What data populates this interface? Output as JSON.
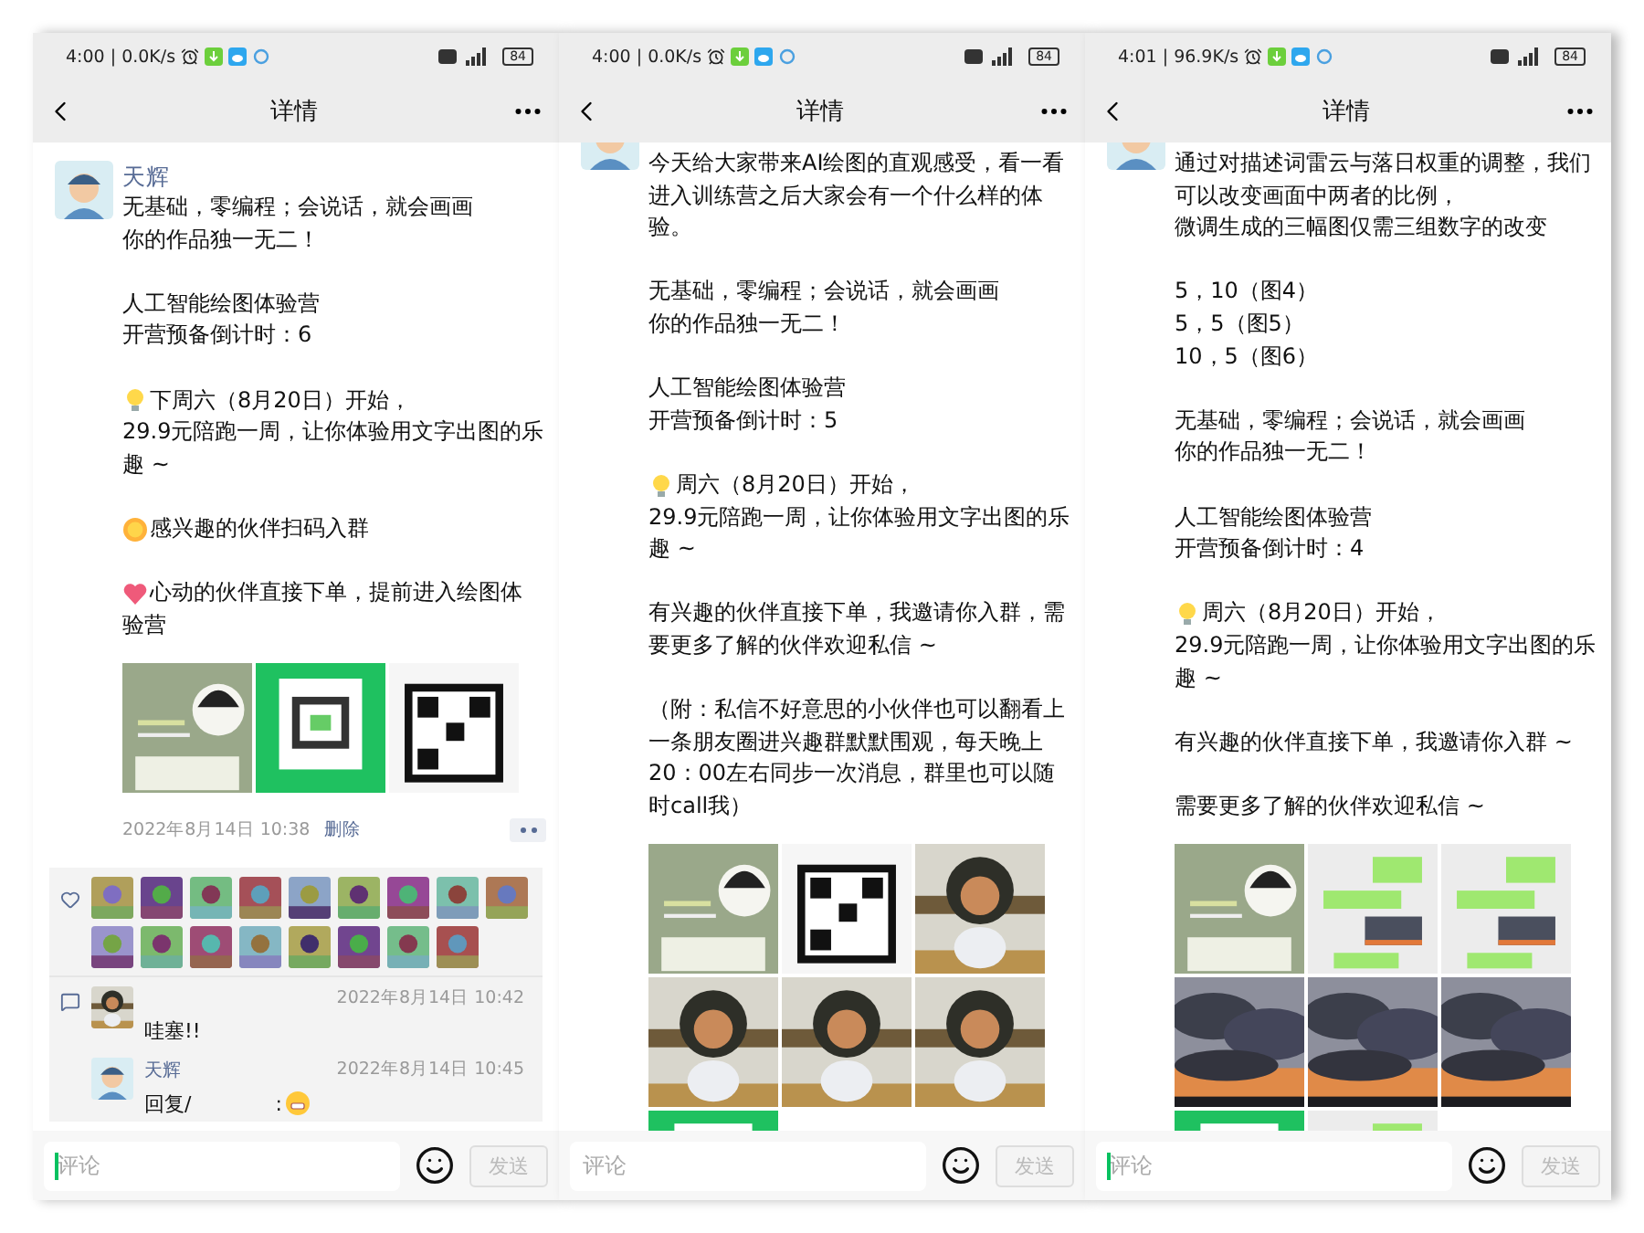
{
  "phones": [
    {
      "status": {
        "time": "4:00 | 0.0K/s",
        "battery": "84"
      },
      "title": "详情",
      "post": {
        "author": "天辉",
        "paragraphs": [
          {
            "lines": [
              "无基础，零编程；会说话，就会画画",
              "你的作品独一无二！"
            ]
          },
          {
            "lines": [
              "人工智能绘图体验营",
              "开营预备倒计时：6"
            ]
          },
          {
            "kind": "bulb",
            "lines": [
              "下周六（8月20日）开始，",
              "29.9元陪跑一周，让你体验用文字出图的乐",
              "趣 ~"
            ]
          },
          {
            "kind": "sun",
            "lines": [
              "感兴趣的伙伴扫码入群"
            ]
          },
          {
            "kind": "heart",
            "lines": [
              "心动的伙伴直接下单，提前进入绘图体",
              "验营"
            ]
          }
        ],
        "time": "2022年8月14日 10:38",
        "delete": "删除",
        "comments": [
          {
            "kind": "comment",
            "time": "2022年8月14日 10:42",
            "text": "哇塞!!"
          },
          {
            "kind": "reply",
            "author": "天辉",
            "time": "2022年8月14日 10:45",
            "text": "回复/",
            "tail": ":"
          }
        ]
      },
      "footer": {
        "placeholder": "评论",
        "focused": true,
        "send": "发送",
        "disabled": true
      }
    },
    {
      "status": {
        "time": "4:00 | 0.0K/s",
        "battery": "84"
      },
      "title": "详情",
      "post": {
        "paragraphs": [
          {
            "lines": [
              "今天给大家带来AI绘图的直观感受，看一看",
              "进入训练营之后大家会有一个什么样的体",
              "验。"
            ]
          },
          {
            "lines": [
              "无基础，零编程；会说话，就会画画",
              "你的作品独一无二！"
            ]
          },
          {
            "lines": [
              "人工智能绘图体验营",
              "开营预备倒计时：5"
            ]
          },
          {
            "kind": "bulb",
            "lines": [
              "周六（8月20日）开始，",
              "29.9元陪跑一周，让你体验用文字出图的乐",
              "趣 ~"
            ]
          },
          {
            "lines": [
              "有兴趣的伙伴直接下单，我邀请你入群，需",
              "要更多了解的伙伴欢迎私信 ~"
            ]
          },
          {
            "lines": [
              "（附：私信不好意思的小伙伴也可以翻看上",
              "一条朋友圈进兴趣群默默围观，每天晚上",
              "20：00左右同步一次消息，群里也可以随",
              "时call我）"
            ]
          }
        ]
      },
      "footer": {
        "placeholder": "评论",
        "focused": false,
        "send": "发送",
        "disabled": true
      }
    },
    {
      "status": {
        "time": "4:01 | 96.9K/s",
        "battery": "84"
      },
      "title": "详情",
      "post": {
        "paragraphs": [
          {
            "lines": [
              "通过对描述词雷云与落日权重的调整，我们",
              "可以改变画面中两者的比例，",
              "微调生成的三幅图仅需三组数字的改变"
            ]
          },
          {
            "lines": [
              "5，10（图4）",
              "5，5（图5）",
              "10，5（图6）"
            ]
          },
          {
            "lines": [
              "无基础，零编程；会说话，就会画画",
              "你的作品独一无二！"
            ]
          },
          {
            "lines": [
              "人工智能绘图体验营",
              "开营预备倒计时：4"
            ]
          },
          {
            "kind": "bulb",
            "lines": [
              "周六（8月20日）开始，",
              "29.9元陪跑一周，让你体验用文字出图的乐",
              "趣 ~"
            ]
          },
          {
            "lines": [
              "有兴趣的伙伴直接下单，我邀请你入群 ~"
            ]
          },
          {
            "lines": [
              "需要更多了解的伙伴欢迎私信 ~"
            ]
          }
        ]
      },
      "footer": {
        "placeholder": "评论",
        "focused": true,
        "send": "发送",
        "disabled": true
      }
    }
  ]
}
